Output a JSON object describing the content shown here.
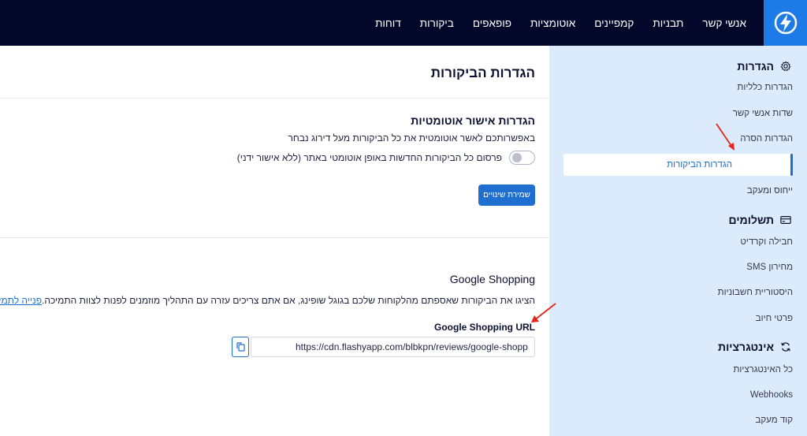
{
  "nav": {
    "items": [
      "אנשי קשר",
      "תבניות",
      "קמפיינים",
      "אוטומציות",
      "פופאפים",
      "ביקורות",
      "דוחות"
    ]
  },
  "sidebar": {
    "settings_title": "הגדרות",
    "settings_items": [
      "הגדרות כלליות",
      "שדות אנשי קשר",
      "הגדרות הסרה",
      "הגדרות הביקורות",
      "ייחוס ומעקב"
    ],
    "payments_title": "תשלומים",
    "payments_items": [
      "חבילה וקרדיט",
      "מחירון SMS",
      "היסטוריית חשבוניות",
      "פרטי חיוב"
    ],
    "integrations_title": "אינטגרציות",
    "integrations_items": [
      "כל האינטגרציות",
      "Webhooks",
      "קוד מעקב"
    ]
  },
  "main": {
    "title": "הגדרות הביקורות",
    "auto_approve": {
      "heading": "הגדרות אישור אוטומטיות",
      "description": "באפשרותכם לאשר אוטומטית את כל הביקורות מעל דירוג נבחר",
      "toggle_label": "פרסום כל הביקורות החדשות באופן אוטומטי באתר (ללא אישור ידני)",
      "save_label": "שמירת שינויים"
    },
    "google_shopping": {
      "heading": "Google Shopping",
      "description": "הציגו את הביקורות שאספתם מהלקוחות שלכם בגוגל שופינג, אם אתם צריכים עזרה עם התהליך מוזמנים לפנות לצוות התמיכה.",
      "support_link": "פנייה לתמיכה",
      "url_label": "Google Shopping URL",
      "url_value": "https://cdn.flashyapp.com/blbkpn/reviews/google-shopping.xml"
    }
  },
  "colors": {
    "topbar": "#03082b",
    "accent": "#1e6fd0",
    "sidebar_bg": "#dcebfb",
    "annotation": "#e8231b"
  }
}
